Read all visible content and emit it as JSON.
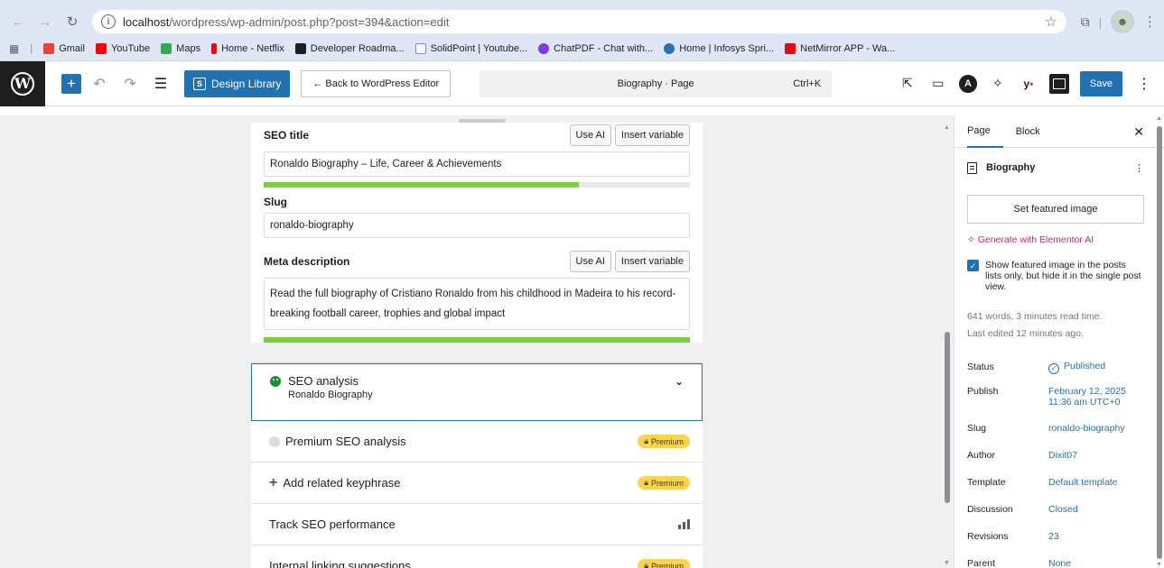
{
  "browser": {
    "url_host": "localhost",
    "url_path": "/wordpress/wp-admin/post.php?post=394&action=edit",
    "bookmarks": [
      {
        "label": "Gmail",
        "color": "#ea4335"
      },
      {
        "label": "YouTube",
        "color": "#ff0000"
      },
      {
        "label": "Maps",
        "color": "#34a853"
      },
      {
        "label": "Home - Netflix",
        "color": "#e50914"
      },
      {
        "label": "Developer Roadma...",
        "color": "#1e1e1e"
      },
      {
        "label": "SolidPoint | Youtube...",
        "color": "#6b8fd6"
      },
      {
        "label": "ChatPDF - Chat with...",
        "color": "#7c3aed"
      },
      {
        "label": "Home | Infosys Spri...",
        "color": "#2f6fb5"
      },
      {
        "label": "NetMirror APP - Wa...",
        "color": "#e50914"
      }
    ]
  },
  "toolbar": {
    "design_library": "Design Library",
    "back_label": "← Back to WordPress Editor",
    "command_title": "Biography · Page",
    "command_shortcut": "Ctrl+K",
    "save_label": "Save"
  },
  "seo": {
    "seo_title_label": "SEO title",
    "use_ai": "Use AI",
    "insert_variable": "Insert variable",
    "seo_title_value": "Ronaldo Biography – Life, Career & Achievements",
    "seo_title_progress": 0.74,
    "slug_label": "Slug",
    "slug_value": "ronaldo-biography",
    "meta_label": "Meta description",
    "meta_value": "Read the full biography of Cristiano Ronaldo from his childhood in Madeira to his record-breaking football career, trophies and global impact",
    "meta_progress": 1.0
  },
  "accordion": {
    "seo_analysis": "SEO analysis",
    "seo_analysis_sub": "Ronaldo Biography",
    "premium_seo": "Premium SEO analysis",
    "related_keyphrase": "Add related keyphrase",
    "track_seo": "Track SEO performance",
    "internal_linking": "Internal linking suggestions",
    "premium_badge": "Premium"
  },
  "sidebar": {
    "tab_page": "Page",
    "tab_block": "Block",
    "doc_title": "Biography",
    "featured_button": "Set featured image",
    "elementor_ai": "✧ Generate with Elementor AI",
    "checkbox_text": "Show featured image in the posts lists only, but hide it in the single post view.",
    "words": "641 words, 3 minutes read time.",
    "last_edited": "Last edited 12 minutes ago.",
    "meta": {
      "status_key": "Status",
      "status_val": "Published",
      "publish_key": "Publish",
      "publish_val_1": "February 12, 2025",
      "publish_val_2": "11:36 am UTC+0",
      "slug_key": "Slug",
      "slug_val": "ronaldo-biography",
      "author_key": "Author",
      "author_val": "Dixit07",
      "template_key": "Template",
      "template_val": "Default template",
      "discussion_key": "Discussion",
      "discussion_val": "Closed",
      "revisions_key": "Revisions",
      "revisions_val": "23",
      "parent_key": "Parent",
      "parent_val": "None"
    }
  }
}
